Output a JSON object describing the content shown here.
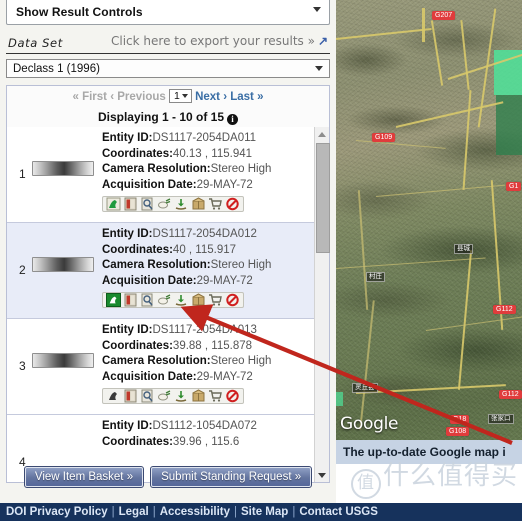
{
  "panel": {
    "show_controls_label": "Show Result Controls",
    "dataset_label": "Data Set",
    "export_link": "Click here to export your results »",
    "export_icon": "external-link-icon",
    "dataset_value": "Declass 1 (1996)"
  },
  "pager": {
    "first": "« First",
    "previous": "‹ Previous",
    "page_value": "1",
    "next": "Next ›",
    "last": "Last »",
    "displaying": "Displaying 1 - 10 of 15",
    "info_glyph": "i"
  },
  "fields": {
    "entity_id": "Entity ID:",
    "coordinates": "Coordinates:",
    "camera_resolution": "Camera Resolution:",
    "acquisition_date": "Acquisition Date:"
  },
  "results": [
    {
      "index": "1",
      "entity_id": "DS1117-2054DA011",
      "coordinates": "40.13 , 115.941",
      "camera_resolution": "Stereo High",
      "acquisition_date": "29-MAY-72",
      "selected": false
    },
    {
      "index": "2",
      "entity_id": "DS1117-2054DA012",
      "coordinates": "40 , 115.917",
      "camera_resolution": "Stereo High",
      "acquisition_date": "29-MAY-72",
      "selected": true
    },
    {
      "index": "3",
      "entity_id": "DS1117-2054DA013",
      "coordinates": "39.88 , 115.878",
      "camera_resolution": "Stereo High",
      "acquisition_date": "29-MAY-72",
      "selected": false
    },
    {
      "index": "4",
      "entity_id": "DS1112-1054DA072",
      "coordinates": "39.96 , 115.6",
      "camera_resolution": "",
      "acquisition_date": "",
      "selected": false
    }
  ],
  "row_icons": [
    "show-footprint-icon",
    "show-browse-overlay-icon",
    "show-metadata-icon",
    "compare-browse-icon",
    "download-options-icon",
    "bulk-download-icon",
    "add-to-cart-icon",
    "not-available-icon"
  ],
  "buttons": {
    "view_item_basket": "View Item Basket »",
    "submit_standing_request": "Submit Standing Request »"
  },
  "map": {
    "google_logo": "Google",
    "caption": "The up-to-date Google map i",
    "road_labels": [
      "G207",
      "G109",
      "G1",
      "G112",
      "G112",
      "G18",
      "G108"
    ],
    "place_labels": [
      "县城",
      "村庄",
      "灵丘县",
      "张家口"
    ]
  },
  "watermark": {
    "circle_char": "值",
    "text": "什么值得买"
  },
  "footer": {
    "links": [
      "DOI Privacy Policy",
      "Legal",
      "Accessibility",
      "Site Map",
      "Contact USGS"
    ],
    "separator": "|"
  },
  "colors": {
    "accent_blue": "#16325c",
    "selected_row": "#e8ecf8",
    "annotation_red": "#c0261d",
    "road_label_red": "#e03c3c"
  }
}
